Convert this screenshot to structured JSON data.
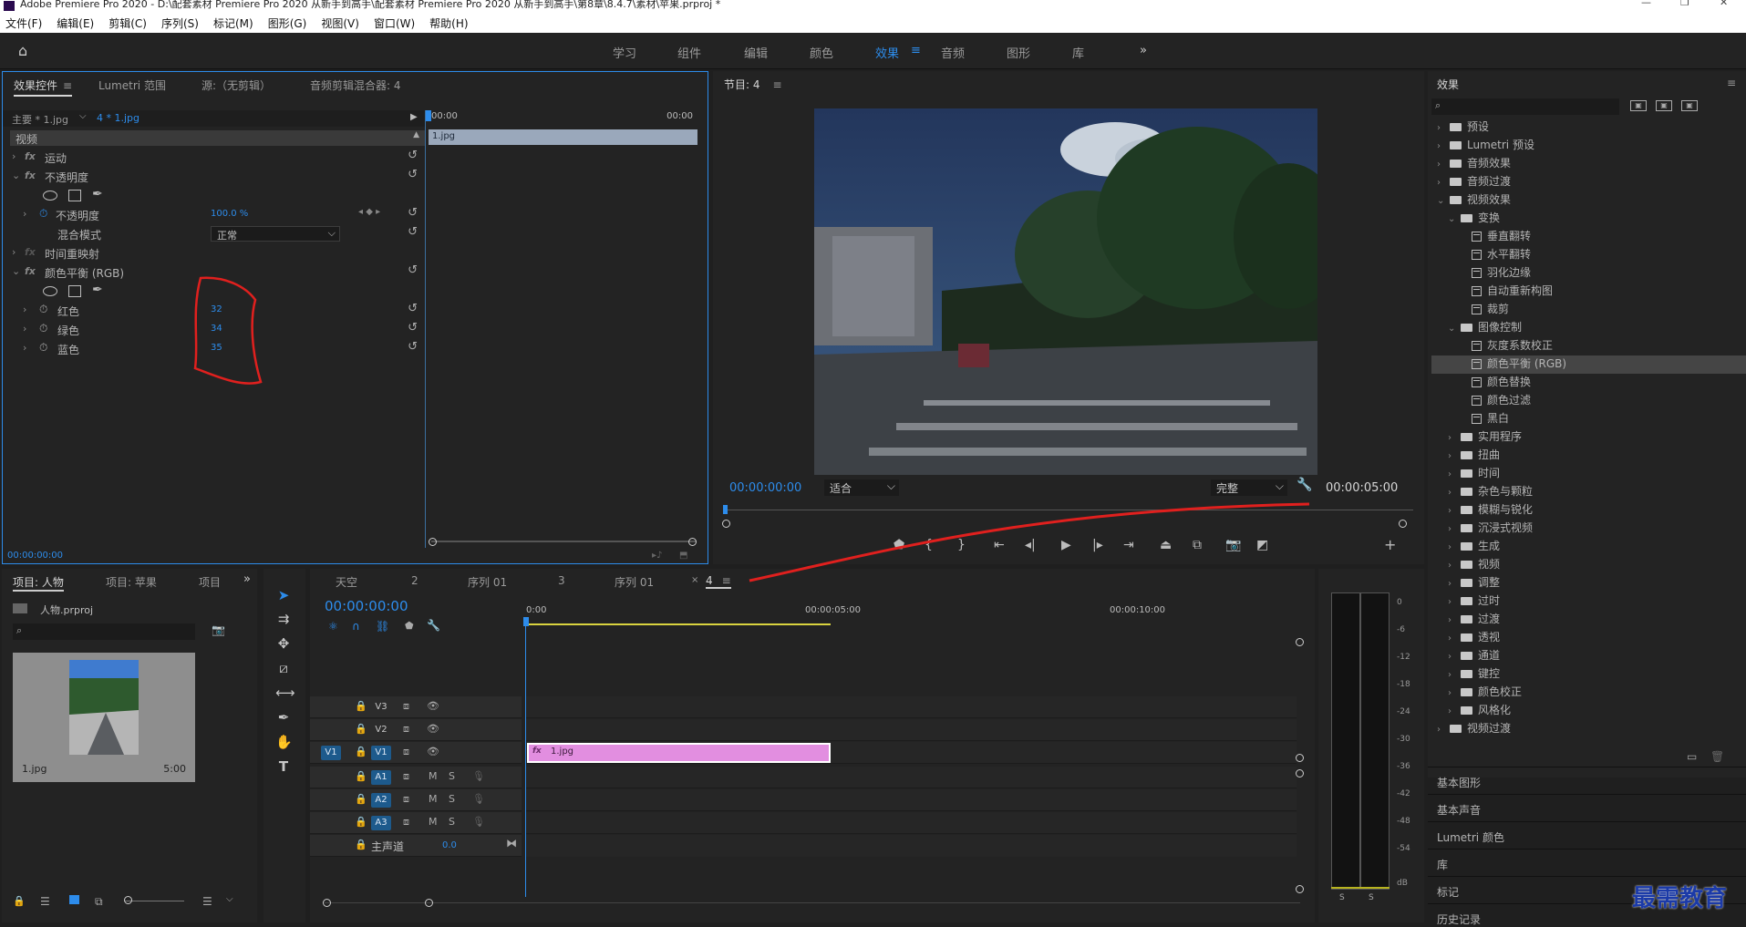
{
  "window": {
    "title": "Adobe Premiere Pro 2020 - D:\\配套素材 Premiere Pro 2020 从新手到高手\\配套素材 Premiere Pro 2020 从新手到高手\\第8章\\8.4.7\\素材\\苹果.prproj *"
  },
  "menu": [
    "文件(F)",
    "编辑(E)",
    "剪辑(C)",
    "序列(S)",
    "标记(M)",
    "图形(G)",
    "视图(V)",
    "窗口(W)",
    "帮助(H)"
  ],
  "workspaces": [
    "学习",
    "组件",
    "编辑",
    "颜色",
    "效果",
    "音频",
    "图形",
    "库"
  ],
  "effect_controls": {
    "tabs": [
      "效果控件",
      "Lumetri 范围",
      "源:（无剪辑）",
      "音频剪辑混合器: 4"
    ],
    "master_label": "主要 * 1.jpg",
    "clip_label": "4 * 1.jpg",
    "section": "视频",
    "motion": "运动",
    "opacity": "不透明度",
    "opacity_param": "不透明度",
    "opacity_value": "100.0 %",
    "blend_label": "混合模式",
    "blend_value": "正常",
    "time_remap": "时间重映射",
    "color_balance": "颜色平衡 (RGB)",
    "red_label": "红色",
    "red_value": "32",
    "green_label": "绿色",
    "green_value": "34",
    "blue_label": "蓝色",
    "blue_value": "35",
    "timecode": "00:00:00:00",
    "mini_tc_start": "00:00",
    "mini_tc_end": "00:00",
    "mini_clip": "1.jpg",
    "fx_glyph": "fx"
  },
  "program": {
    "title": "节目: 4",
    "timecode": "00:00:00:00",
    "fit": "适合",
    "quality": "完整",
    "duration": "00:00:05:00"
  },
  "effects_panel": {
    "title": "效果",
    "items": [
      {
        "label": "预设",
        "level": 0,
        "type": "folder",
        "open": false
      },
      {
        "label": "Lumetri 预设",
        "level": 0,
        "type": "folder",
        "open": false
      },
      {
        "label": "音频效果",
        "level": 0,
        "type": "folder",
        "open": false
      },
      {
        "label": "音频过渡",
        "level": 0,
        "type": "folder",
        "open": false
      },
      {
        "label": "视频效果",
        "level": 0,
        "type": "folder",
        "open": true
      },
      {
        "label": "变换",
        "level": 1,
        "type": "folder",
        "open": true
      },
      {
        "label": "垂直翻转",
        "level": 2,
        "type": "effect"
      },
      {
        "label": "水平翻转",
        "level": 2,
        "type": "effect"
      },
      {
        "label": "羽化边缘",
        "level": 2,
        "type": "effect"
      },
      {
        "label": "自动重新构图",
        "level": 2,
        "type": "effect"
      },
      {
        "label": "裁剪",
        "level": 2,
        "type": "effect"
      },
      {
        "label": "图像控制",
        "level": 1,
        "type": "folder",
        "open": true
      },
      {
        "label": "灰度系数校正",
        "level": 2,
        "type": "effect"
      },
      {
        "label": "颜色平衡 (RGB)",
        "level": 2,
        "type": "effect",
        "selected": true
      },
      {
        "label": "颜色替换",
        "level": 2,
        "type": "effect"
      },
      {
        "label": "颜色过滤",
        "level": 2,
        "type": "effect"
      },
      {
        "label": "黑白",
        "level": 2,
        "type": "effect"
      },
      {
        "label": "实用程序",
        "level": 1,
        "type": "folder",
        "open": false
      },
      {
        "label": "扭曲",
        "level": 1,
        "type": "folder",
        "open": false
      },
      {
        "label": "时间",
        "level": 1,
        "type": "folder",
        "open": false
      },
      {
        "label": "杂色与颗粒",
        "level": 1,
        "type": "folder",
        "open": false
      },
      {
        "label": "模糊与锐化",
        "level": 1,
        "type": "folder",
        "open": false
      },
      {
        "label": "沉浸式视频",
        "level": 1,
        "type": "folder",
        "open": false
      },
      {
        "label": "生成",
        "level": 1,
        "type": "folder",
        "open": false
      },
      {
        "label": "视频",
        "level": 1,
        "type": "folder",
        "open": false
      },
      {
        "label": "调整",
        "level": 1,
        "type": "folder",
        "open": false
      },
      {
        "label": "过时",
        "level": 1,
        "type": "folder",
        "open": false
      },
      {
        "label": "过渡",
        "level": 1,
        "type": "folder",
        "open": false
      },
      {
        "label": "透视",
        "level": 1,
        "type": "folder",
        "open": false
      },
      {
        "label": "通道",
        "level": 1,
        "type": "folder",
        "open": false
      },
      {
        "label": "键控",
        "level": 1,
        "type": "folder",
        "open": false
      },
      {
        "label": "颜色校正",
        "level": 1,
        "type": "folder",
        "open": false
      },
      {
        "label": "风格化",
        "level": 1,
        "type": "folder",
        "open": false
      },
      {
        "label": "视频过渡",
        "level": 0,
        "type": "folder",
        "open": false
      }
    ],
    "stack": [
      "基本图形",
      "基本声音",
      "Lumetri 颜色",
      "库",
      "标记",
      "历史记录"
    ]
  },
  "project": {
    "tabs": [
      "项目: 人物",
      "项目: 苹果",
      "项目"
    ],
    "file": "人物.prproj",
    "thumb_name": "1.jpg",
    "thumb_duration": "5:00"
  },
  "timeline": {
    "tabs": [
      "天空",
      "2",
      "序列 01",
      "3",
      "序列 01",
      "4"
    ],
    "timecode": "00:00:00:00",
    "ruler": [
      "0:00",
      "00:00:05:00",
      "00:00:10:00"
    ],
    "video_tracks": [
      "V3",
      "V2",
      "V1"
    ],
    "audio_tracks": [
      "A1",
      "A2",
      "A3"
    ],
    "source_patch": "V1",
    "master": "主声道",
    "master_value": "0.0",
    "clip_name": "1.jpg",
    "clip_fx": "fx",
    "mute": "M",
    "solo": "S"
  },
  "meter": {
    "labels": [
      "0",
      "-6",
      "-12",
      "-18",
      "-24",
      "-30",
      "-36",
      "-42",
      "-48",
      "-54",
      "dB"
    ],
    "solo": "S"
  },
  "watermark": "最需教育",
  "colors": {
    "accent": "#2d8ceb",
    "clip": "#e28ee0",
    "annotation": "#e0201e"
  }
}
